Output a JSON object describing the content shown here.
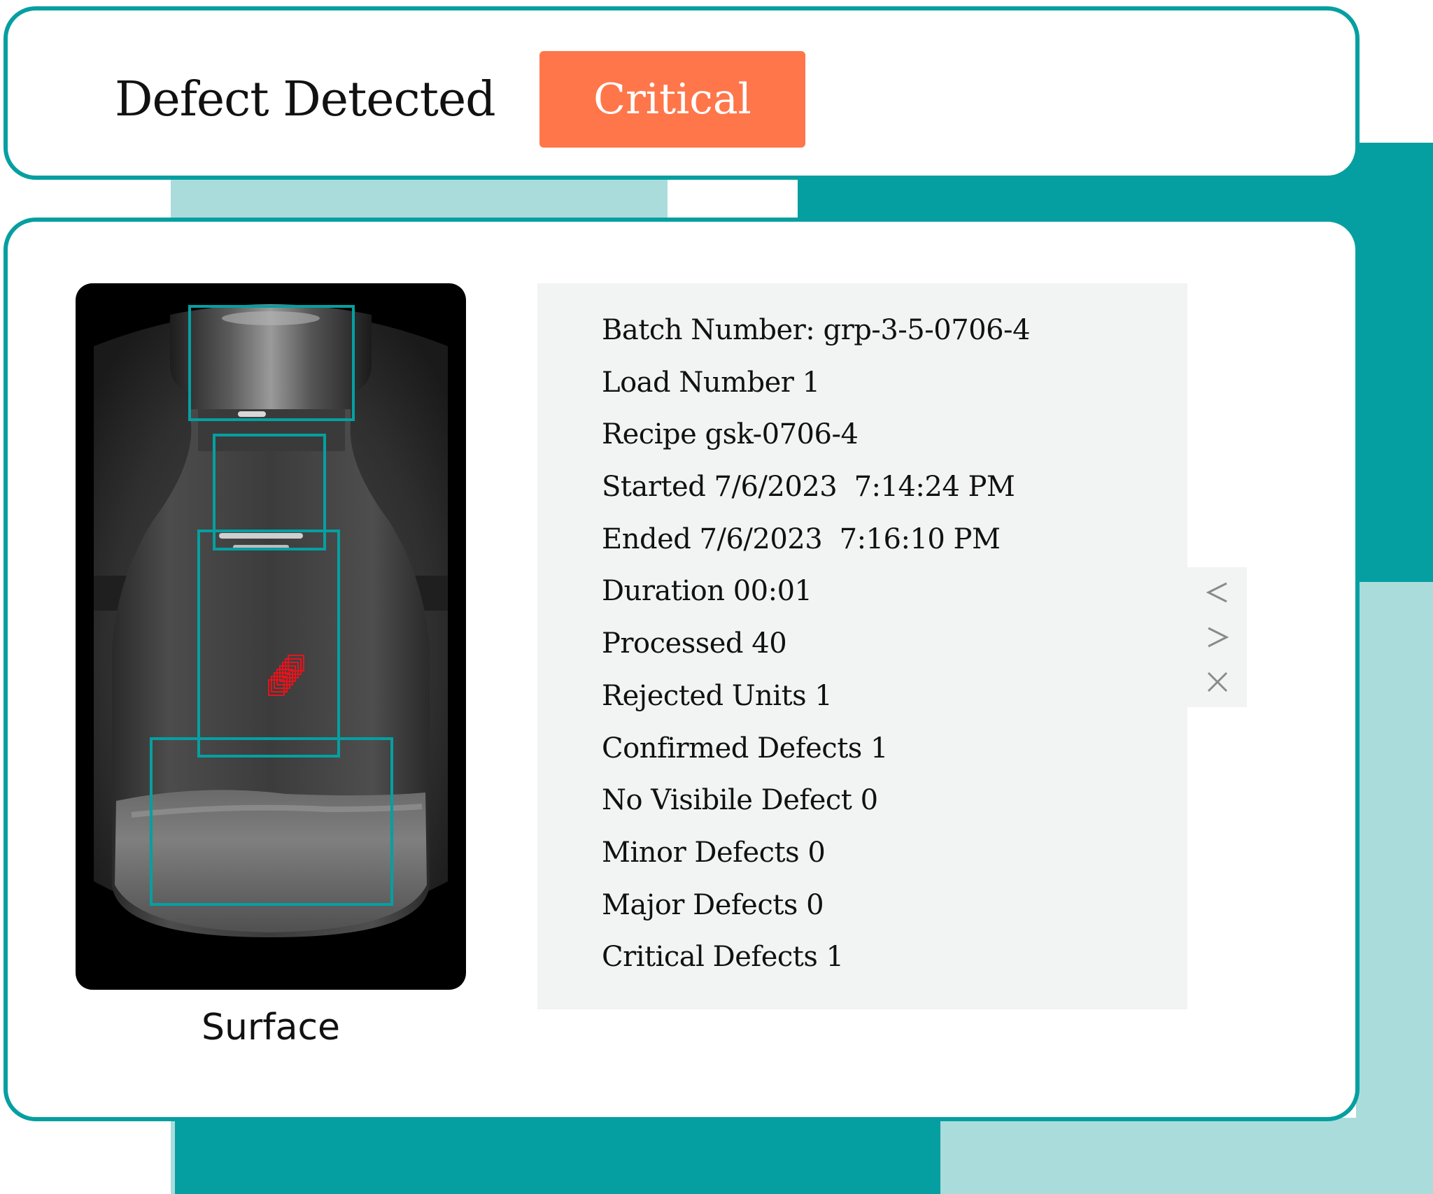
{
  "header": {
    "title": "Defect Detected",
    "severity_badge": "Critical"
  },
  "inspection": {
    "image_caption": "Surface",
    "details": [
      "Batch Number: grp-3-5-0706-4",
      "Load Number 1",
      "Recipe gsk-0706-4",
      "Started 7/6/2023  7:14:24 PM",
      "Ended 7/6/2023  7:16:10 PM",
      "Duration 00:01",
      "Processed 40",
      "Rejected Units 1",
      "Confirmed Defects 1",
      "No Visibile Defect 0",
      "Minor Defects 0",
      "Major Defects 0",
      "Critical Defects 1"
    ]
  },
  "navigation": {
    "icons": [
      "previous-icon",
      "next-icon",
      "close-icon"
    ]
  },
  "colors": {
    "teal": "#069fa1",
    "light_teal": "#abdcdc",
    "critical": "#ff764a",
    "defect_marker": "#e8121b",
    "panel_bg": "#f2f3f3"
  }
}
